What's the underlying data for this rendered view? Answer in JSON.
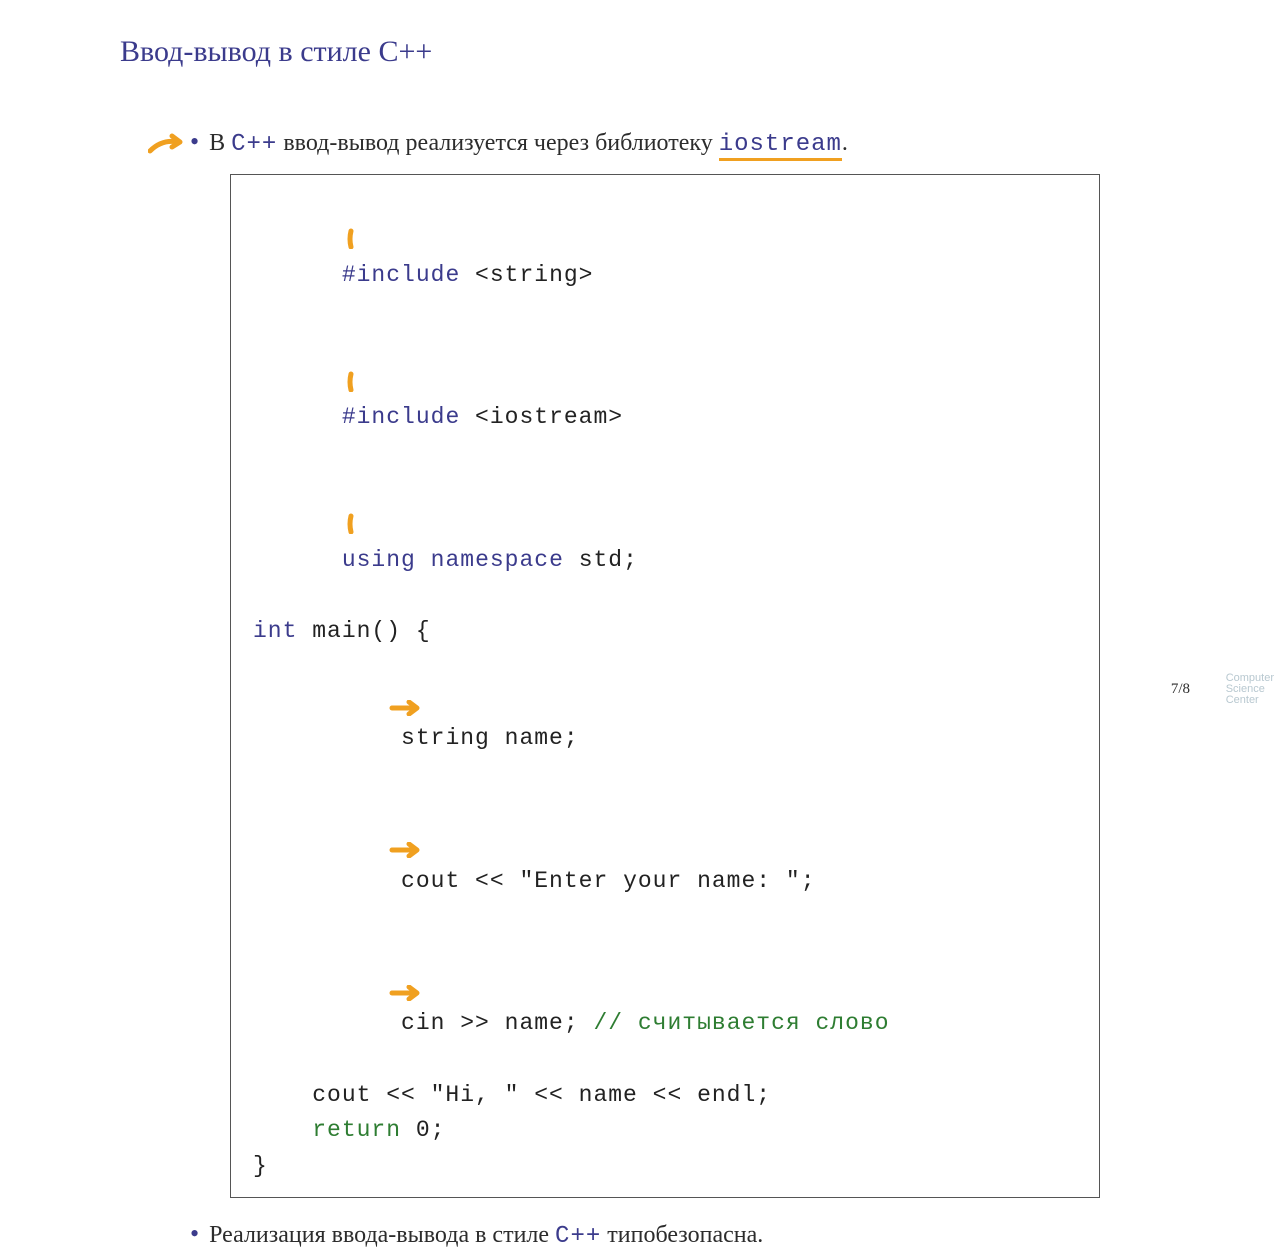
{
  "title": "Ввод-вывод в стиле C++",
  "bullet1_pre": "В ",
  "bullet1_code": "C++",
  "bullet1_mid": " ввод-вывод реализуется через библиотеку ",
  "bullet1_lib": "iostream",
  "bullet1_end": ".",
  "code": {
    "l1_a": "#include",
    "l1_b": " <string>",
    "l2_a": "#include",
    "l2_b": " <iostream>",
    "l3_a": "using",
    "l3_b": " ",
    "l3_c": "namespace",
    "l3_d": " std;",
    "l4": "",
    "l5_a": "int",
    "l5_b": " main() {",
    "l6": "    string name;",
    "l7": "    cout << \"Enter your name: \";",
    "l8a": "    cin >> name; ",
    "l8b": "// считывается слово",
    "l9": "    cout << \"Hi, \" << name << endl;",
    "l10": "",
    "l11_a": "    ",
    "l11_b": "return",
    "l11_c": " 0;",
    "l12": "}"
  },
  "bullet2_pre": "Реализация ввода-вывода в стиле ",
  "bullet2_code": "C++",
  "bullet2_end": " типобезопасна.",
  "page": "7/8",
  "logo1": "Computer",
  "logo2": "Science",
  "logo3": "Center"
}
